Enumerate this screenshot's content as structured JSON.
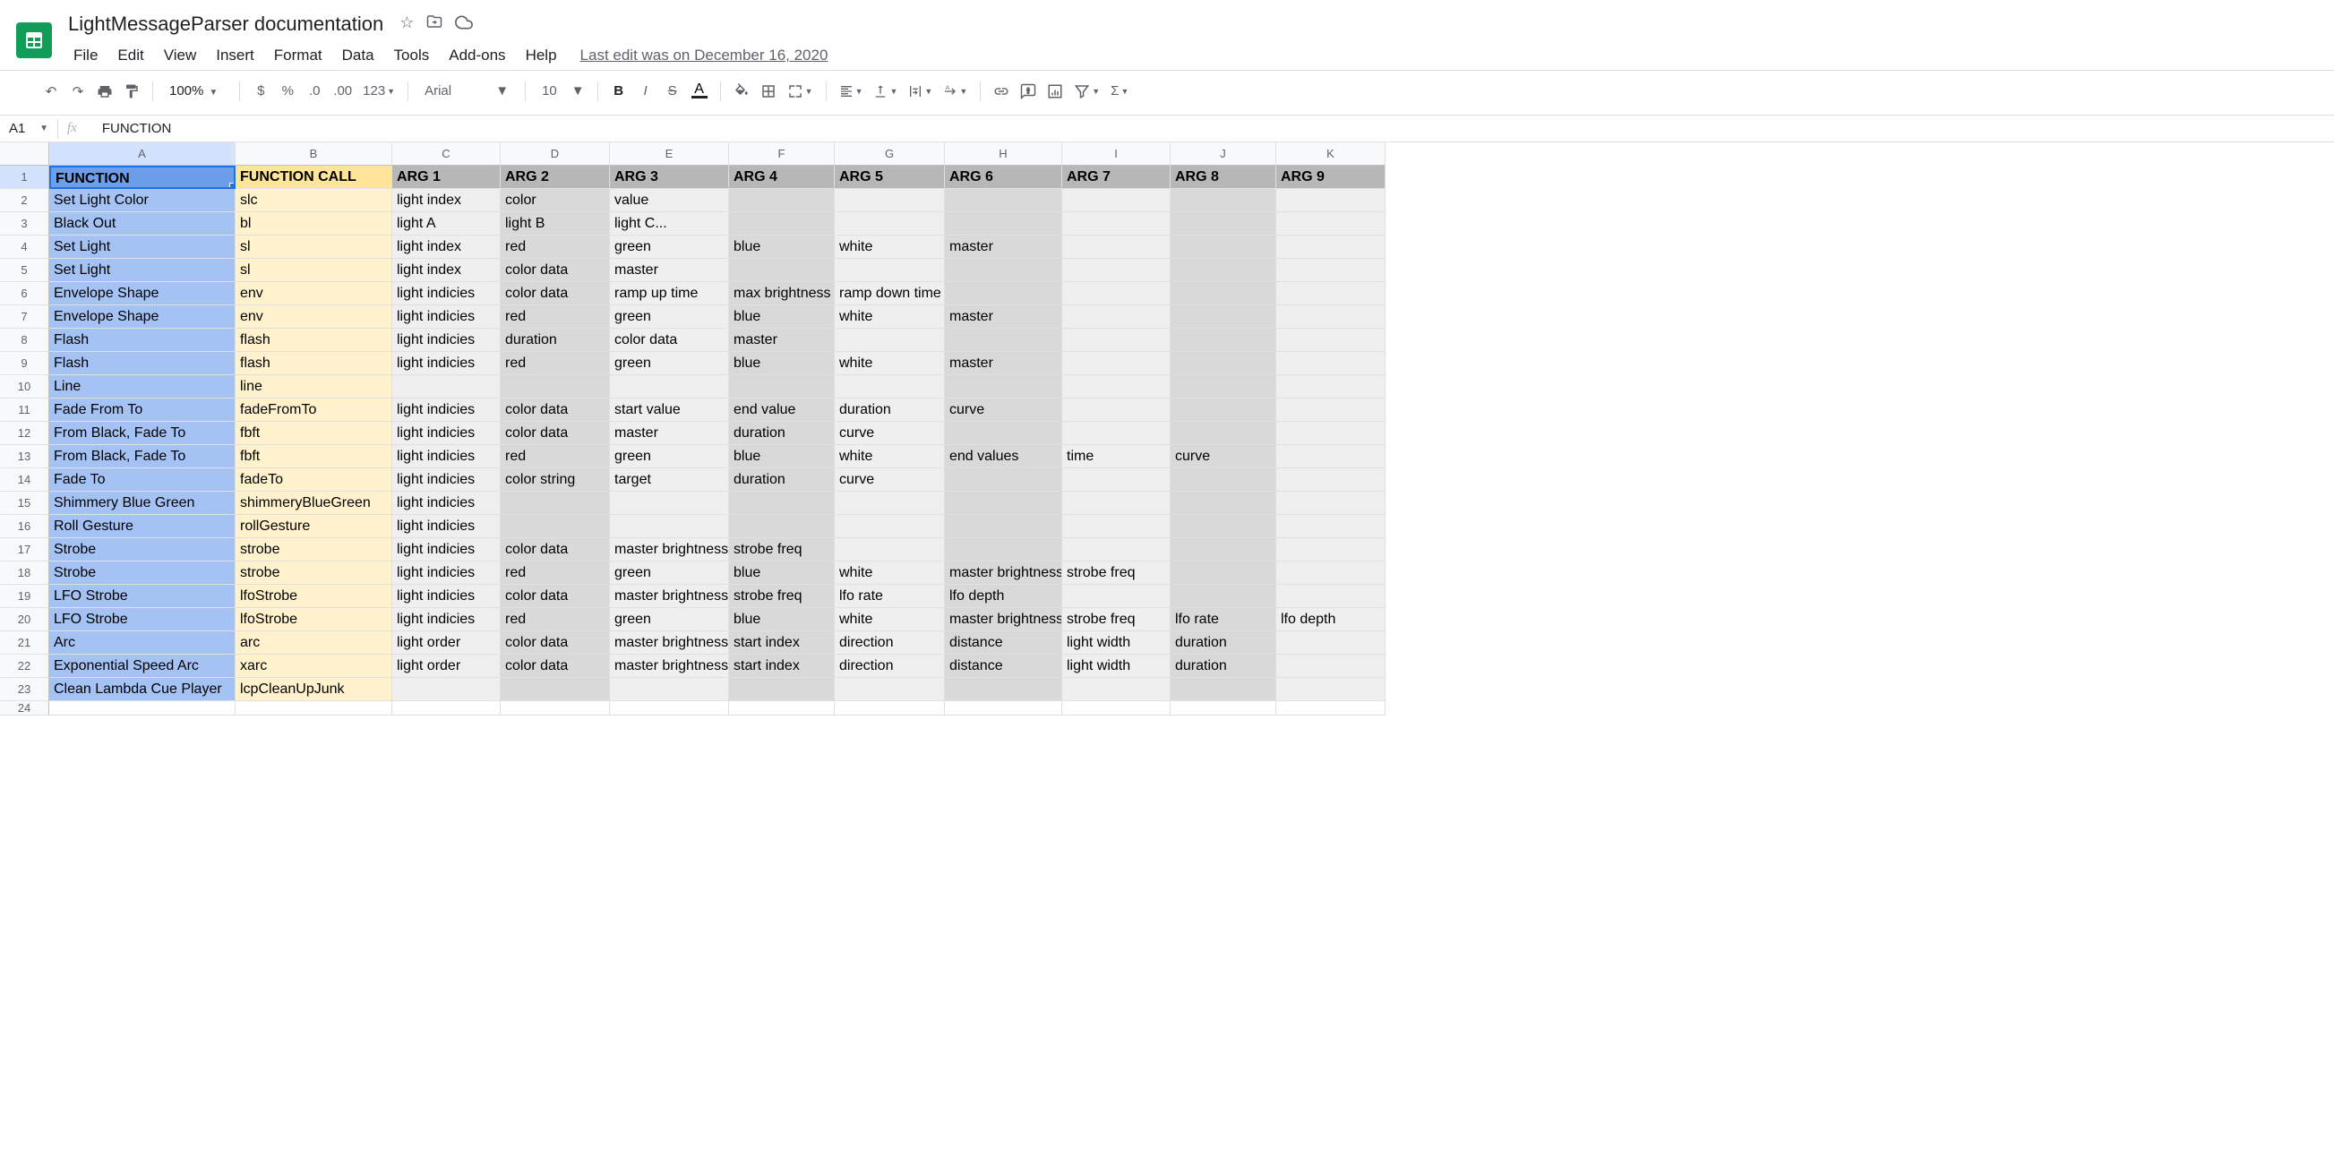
{
  "doc": {
    "title": "LightMessageParser documentation",
    "last_edit": "Last edit was on December 16, 2020"
  },
  "menubar": [
    "File",
    "Edit",
    "View",
    "Insert",
    "Format",
    "Data",
    "Tools",
    "Add-ons",
    "Help"
  ],
  "toolbar": {
    "zoom": "100%",
    "font": "Arial",
    "size": "10",
    "format_auto": "123"
  },
  "namebox": "A1",
  "fx_value": "FUNCTION",
  "columns": [
    "A",
    "B",
    "C",
    "D",
    "E",
    "F",
    "G",
    "H",
    "I",
    "J",
    "K"
  ],
  "row_numbers": [
    1,
    2,
    3,
    4,
    5,
    6,
    7,
    8,
    9,
    10,
    11,
    12,
    13,
    14,
    15,
    16,
    17,
    18,
    19,
    20,
    21,
    22,
    23,
    24
  ],
  "header_row": {
    "func": "FUNCTION",
    "call": "FUNCTION CALL",
    "args": [
      "ARG 1",
      "ARG 2",
      "ARG 3",
      "ARG 4",
      "ARG 5",
      "ARG 6",
      "ARG 7",
      "ARG 8",
      "ARG 9"
    ]
  },
  "rows": [
    {
      "func": "Set Light Color",
      "call": "slc",
      "args": [
        "light index",
        "color",
        "value",
        "",
        "",
        "",
        "",
        "",
        ""
      ]
    },
    {
      "func": "Black Out",
      "call": "bl",
      "args": [
        "light A",
        "light B",
        "light C...",
        "",
        "",
        "",
        "",
        "",
        ""
      ]
    },
    {
      "func": "Set Light",
      "call": "sl",
      "args": [
        "light index",
        "red",
        "green",
        "blue",
        "white",
        "master",
        "",
        "",
        ""
      ]
    },
    {
      "func": "Set Light",
      "call": "sl",
      "args": [
        "light index",
        "color data",
        "master",
        "",
        "",
        "",
        "",
        "",
        ""
      ]
    },
    {
      "func": "Envelope Shape",
      "call": "env",
      "args": [
        "light indicies",
        "color data",
        "ramp up time",
        "max brightness",
        "ramp down time",
        "",
        "",
        "",
        ""
      ]
    },
    {
      "func": "Envelope Shape",
      "call": "env",
      "args": [
        "light indicies",
        "red",
        "green",
        "blue",
        "white",
        "master",
        "",
        "",
        ""
      ]
    },
    {
      "func": "Flash",
      "call": "flash",
      "args": [
        "light indicies",
        "duration",
        "color data",
        "master",
        "",
        "",
        "",
        "",
        ""
      ]
    },
    {
      "func": "Flash",
      "call": "flash",
      "args": [
        "light indicies",
        "red",
        "green",
        " blue",
        "white",
        "master",
        "",
        "",
        ""
      ]
    },
    {
      "func": "Line",
      "call": "line",
      "args": [
        "",
        "",
        "",
        "",
        "",
        "",
        "",
        "",
        ""
      ]
    },
    {
      "func": "Fade From To",
      "call": "fadeFromTo",
      "args": [
        "light indicies",
        "color data",
        "start value",
        "end value",
        "duration",
        "curve",
        "",
        "",
        ""
      ]
    },
    {
      "func": "From Black, Fade To",
      "call": "fbft",
      "args": [
        "light indicies",
        "color data",
        "master",
        "duration",
        "curve",
        "",
        "",
        "",
        ""
      ]
    },
    {
      "func": "From Black, Fade To",
      "call": "fbft",
      "args": [
        "light indicies",
        "red",
        "green",
        "blue",
        "white",
        "end values",
        "time",
        "curve",
        ""
      ]
    },
    {
      "func": "Fade To",
      "call": "fadeTo",
      "args": [
        "light indicies",
        "color string",
        "target",
        "duration",
        "curve",
        "",
        "",
        "",
        ""
      ]
    },
    {
      "func": "Shimmery Blue Green",
      "call": "shimmeryBlueGreen",
      "args": [
        "light indicies",
        "",
        "",
        "",
        "",
        "",
        "",
        "",
        ""
      ]
    },
    {
      "func": "Roll Gesture",
      "call": "rollGesture",
      "args": [
        "light indicies",
        "",
        "",
        "",
        "",
        "",
        "",
        "",
        ""
      ]
    },
    {
      "func": "Strobe",
      "call": "strobe",
      "args": [
        "light indicies",
        "color data",
        "master brightness",
        "strobe freq",
        "",
        "",
        "",
        "",
        ""
      ]
    },
    {
      "func": "Strobe",
      "call": "strobe",
      "args": [
        "light indicies",
        "red",
        "green",
        "blue",
        "white",
        "master brightness",
        "strobe freq",
        "",
        ""
      ]
    },
    {
      "func": "LFO Strobe",
      "call": "lfoStrobe",
      "args": [
        "light indicies",
        "color data",
        "master brightness",
        "strobe freq",
        "lfo rate",
        "lfo depth",
        "",
        "",
        ""
      ]
    },
    {
      "func": "LFO Strobe",
      "call": "lfoStrobe",
      "args": [
        "light indicies",
        "red",
        "green",
        "blue",
        "white",
        "master brightness",
        "strobe freq",
        "lfo rate",
        "lfo depth"
      ]
    },
    {
      "func": "Arc",
      "call": "arc",
      "args": [
        "light order",
        "color data",
        "master brightness",
        "start index",
        "direction",
        "distance",
        "light width",
        "duration",
        ""
      ]
    },
    {
      "func": "Exponential Speed Arc",
      "call": "xarc",
      "args": [
        "light order",
        "color data",
        "master brightness",
        "start index",
        "direction",
        "distance",
        "light width",
        "duration",
        ""
      ]
    },
    {
      "func": "Clean Lambda Cue Player",
      "call": "lcpCleanUpJunk",
      "args": [
        "",
        "",
        "",
        "",
        "",
        "",
        "",
        "",
        ""
      ]
    }
  ]
}
